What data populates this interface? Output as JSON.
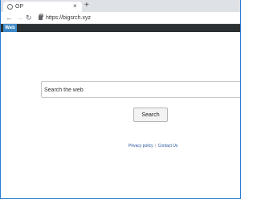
{
  "browser": {
    "tab_title": "OP",
    "tab_close_glyph": "×",
    "new_tab_glyph": "+",
    "url": "https://bigsrch.xyz",
    "icons": [
      "globe-icon",
      "close-icon",
      "plus-icon",
      "back-arrow-icon",
      "forward-arrow-icon",
      "reload-icon",
      "lock-icon"
    ]
  },
  "header": {
    "active_tab": "Web",
    "accent_color": "#3d88c6",
    "bar_color": "#2b3033"
  },
  "search": {
    "placeholder": "Search the web",
    "button_label": "Search"
  },
  "footer": {
    "privacy_link": "Privacy policy",
    "separator": "|",
    "contact_link": "Contact Us"
  }
}
